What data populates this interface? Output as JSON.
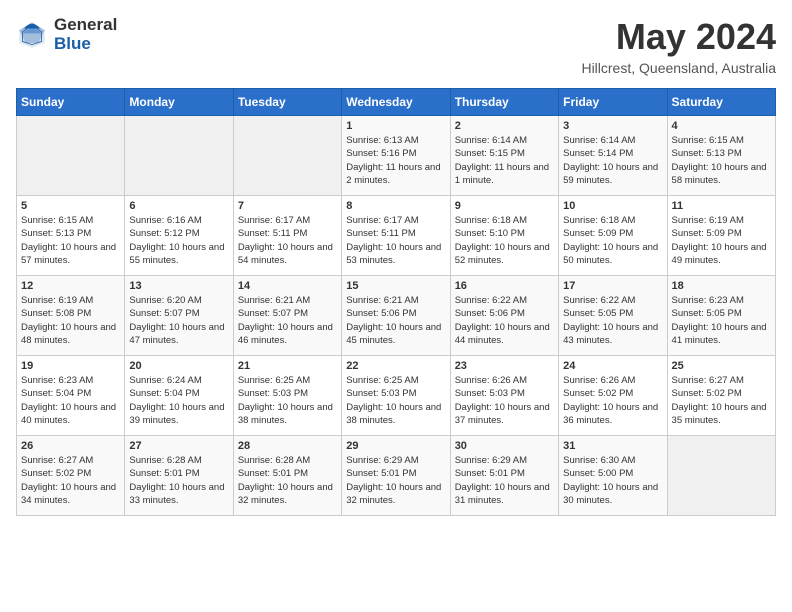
{
  "logo": {
    "general": "General",
    "blue": "Blue"
  },
  "calendar": {
    "title": "May 2024",
    "subtitle": "Hillcrest, Queensland, Australia"
  },
  "headers": [
    "Sunday",
    "Monday",
    "Tuesday",
    "Wednesday",
    "Thursday",
    "Friday",
    "Saturday"
  ],
  "weeks": [
    [
      {
        "day": "",
        "sunrise": "",
        "sunset": "",
        "daylight": ""
      },
      {
        "day": "",
        "sunrise": "",
        "sunset": "",
        "daylight": ""
      },
      {
        "day": "",
        "sunrise": "",
        "sunset": "",
        "daylight": ""
      },
      {
        "day": "1",
        "sunrise": "Sunrise: 6:13 AM",
        "sunset": "Sunset: 5:16 PM",
        "daylight": "Daylight: 11 hours and 2 minutes."
      },
      {
        "day": "2",
        "sunrise": "Sunrise: 6:14 AM",
        "sunset": "Sunset: 5:15 PM",
        "daylight": "Daylight: 11 hours and 1 minute."
      },
      {
        "day": "3",
        "sunrise": "Sunrise: 6:14 AM",
        "sunset": "Sunset: 5:14 PM",
        "daylight": "Daylight: 10 hours and 59 minutes."
      },
      {
        "day": "4",
        "sunrise": "Sunrise: 6:15 AM",
        "sunset": "Sunset: 5:13 PM",
        "daylight": "Daylight: 10 hours and 58 minutes."
      }
    ],
    [
      {
        "day": "5",
        "sunrise": "Sunrise: 6:15 AM",
        "sunset": "Sunset: 5:13 PM",
        "daylight": "Daylight: 10 hours and 57 minutes."
      },
      {
        "day": "6",
        "sunrise": "Sunrise: 6:16 AM",
        "sunset": "Sunset: 5:12 PM",
        "daylight": "Daylight: 10 hours and 55 minutes."
      },
      {
        "day": "7",
        "sunrise": "Sunrise: 6:17 AM",
        "sunset": "Sunset: 5:11 PM",
        "daylight": "Daylight: 10 hours and 54 minutes."
      },
      {
        "day": "8",
        "sunrise": "Sunrise: 6:17 AM",
        "sunset": "Sunset: 5:11 PM",
        "daylight": "Daylight: 10 hours and 53 minutes."
      },
      {
        "day": "9",
        "sunrise": "Sunrise: 6:18 AM",
        "sunset": "Sunset: 5:10 PM",
        "daylight": "Daylight: 10 hours and 52 minutes."
      },
      {
        "day": "10",
        "sunrise": "Sunrise: 6:18 AM",
        "sunset": "Sunset: 5:09 PM",
        "daylight": "Daylight: 10 hours and 50 minutes."
      },
      {
        "day": "11",
        "sunrise": "Sunrise: 6:19 AM",
        "sunset": "Sunset: 5:09 PM",
        "daylight": "Daylight: 10 hours and 49 minutes."
      }
    ],
    [
      {
        "day": "12",
        "sunrise": "Sunrise: 6:19 AM",
        "sunset": "Sunset: 5:08 PM",
        "daylight": "Daylight: 10 hours and 48 minutes."
      },
      {
        "day": "13",
        "sunrise": "Sunrise: 6:20 AM",
        "sunset": "Sunset: 5:07 PM",
        "daylight": "Daylight: 10 hours and 47 minutes."
      },
      {
        "day": "14",
        "sunrise": "Sunrise: 6:21 AM",
        "sunset": "Sunset: 5:07 PM",
        "daylight": "Daylight: 10 hours and 46 minutes."
      },
      {
        "day": "15",
        "sunrise": "Sunrise: 6:21 AM",
        "sunset": "Sunset: 5:06 PM",
        "daylight": "Daylight: 10 hours and 45 minutes."
      },
      {
        "day": "16",
        "sunrise": "Sunrise: 6:22 AM",
        "sunset": "Sunset: 5:06 PM",
        "daylight": "Daylight: 10 hours and 44 minutes."
      },
      {
        "day": "17",
        "sunrise": "Sunrise: 6:22 AM",
        "sunset": "Sunset: 5:05 PM",
        "daylight": "Daylight: 10 hours and 43 minutes."
      },
      {
        "day": "18",
        "sunrise": "Sunrise: 6:23 AM",
        "sunset": "Sunset: 5:05 PM",
        "daylight": "Daylight: 10 hours and 41 minutes."
      }
    ],
    [
      {
        "day": "19",
        "sunrise": "Sunrise: 6:23 AM",
        "sunset": "Sunset: 5:04 PM",
        "daylight": "Daylight: 10 hours and 40 minutes."
      },
      {
        "day": "20",
        "sunrise": "Sunrise: 6:24 AM",
        "sunset": "Sunset: 5:04 PM",
        "daylight": "Daylight: 10 hours and 39 minutes."
      },
      {
        "day": "21",
        "sunrise": "Sunrise: 6:25 AM",
        "sunset": "Sunset: 5:03 PM",
        "daylight": "Daylight: 10 hours and 38 minutes."
      },
      {
        "day": "22",
        "sunrise": "Sunrise: 6:25 AM",
        "sunset": "Sunset: 5:03 PM",
        "daylight": "Daylight: 10 hours and 38 minutes."
      },
      {
        "day": "23",
        "sunrise": "Sunrise: 6:26 AM",
        "sunset": "Sunset: 5:03 PM",
        "daylight": "Daylight: 10 hours and 37 minutes."
      },
      {
        "day": "24",
        "sunrise": "Sunrise: 6:26 AM",
        "sunset": "Sunset: 5:02 PM",
        "daylight": "Daylight: 10 hours and 36 minutes."
      },
      {
        "day": "25",
        "sunrise": "Sunrise: 6:27 AM",
        "sunset": "Sunset: 5:02 PM",
        "daylight": "Daylight: 10 hours and 35 minutes."
      }
    ],
    [
      {
        "day": "26",
        "sunrise": "Sunrise: 6:27 AM",
        "sunset": "Sunset: 5:02 PM",
        "daylight": "Daylight: 10 hours and 34 minutes."
      },
      {
        "day": "27",
        "sunrise": "Sunrise: 6:28 AM",
        "sunset": "Sunset: 5:01 PM",
        "daylight": "Daylight: 10 hours and 33 minutes."
      },
      {
        "day": "28",
        "sunrise": "Sunrise: 6:28 AM",
        "sunset": "Sunset: 5:01 PM",
        "daylight": "Daylight: 10 hours and 32 minutes."
      },
      {
        "day": "29",
        "sunrise": "Sunrise: 6:29 AM",
        "sunset": "Sunset: 5:01 PM",
        "daylight": "Daylight: 10 hours and 32 minutes."
      },
      {
        "day": "30",
        "sunrise": "Sunrise: 6:29 AM",
        "sunset": "Sunset: 5:01 PM",
        "daylight": "Daylight: 10 hours and 31 minutes."
      },
      {
        "day": "31",
        "sunrise": "Sunrise: 6:30 AM",
        "sunset": "Sunset: 5:00 PM",
        "daylight": "Daylight: 10 hours and 30 minutes."
      },
      {
        "day": "",
        "sunrise": "",
        "sunset": "",
        "daylight": ""
      }
    ]
  ]
}
